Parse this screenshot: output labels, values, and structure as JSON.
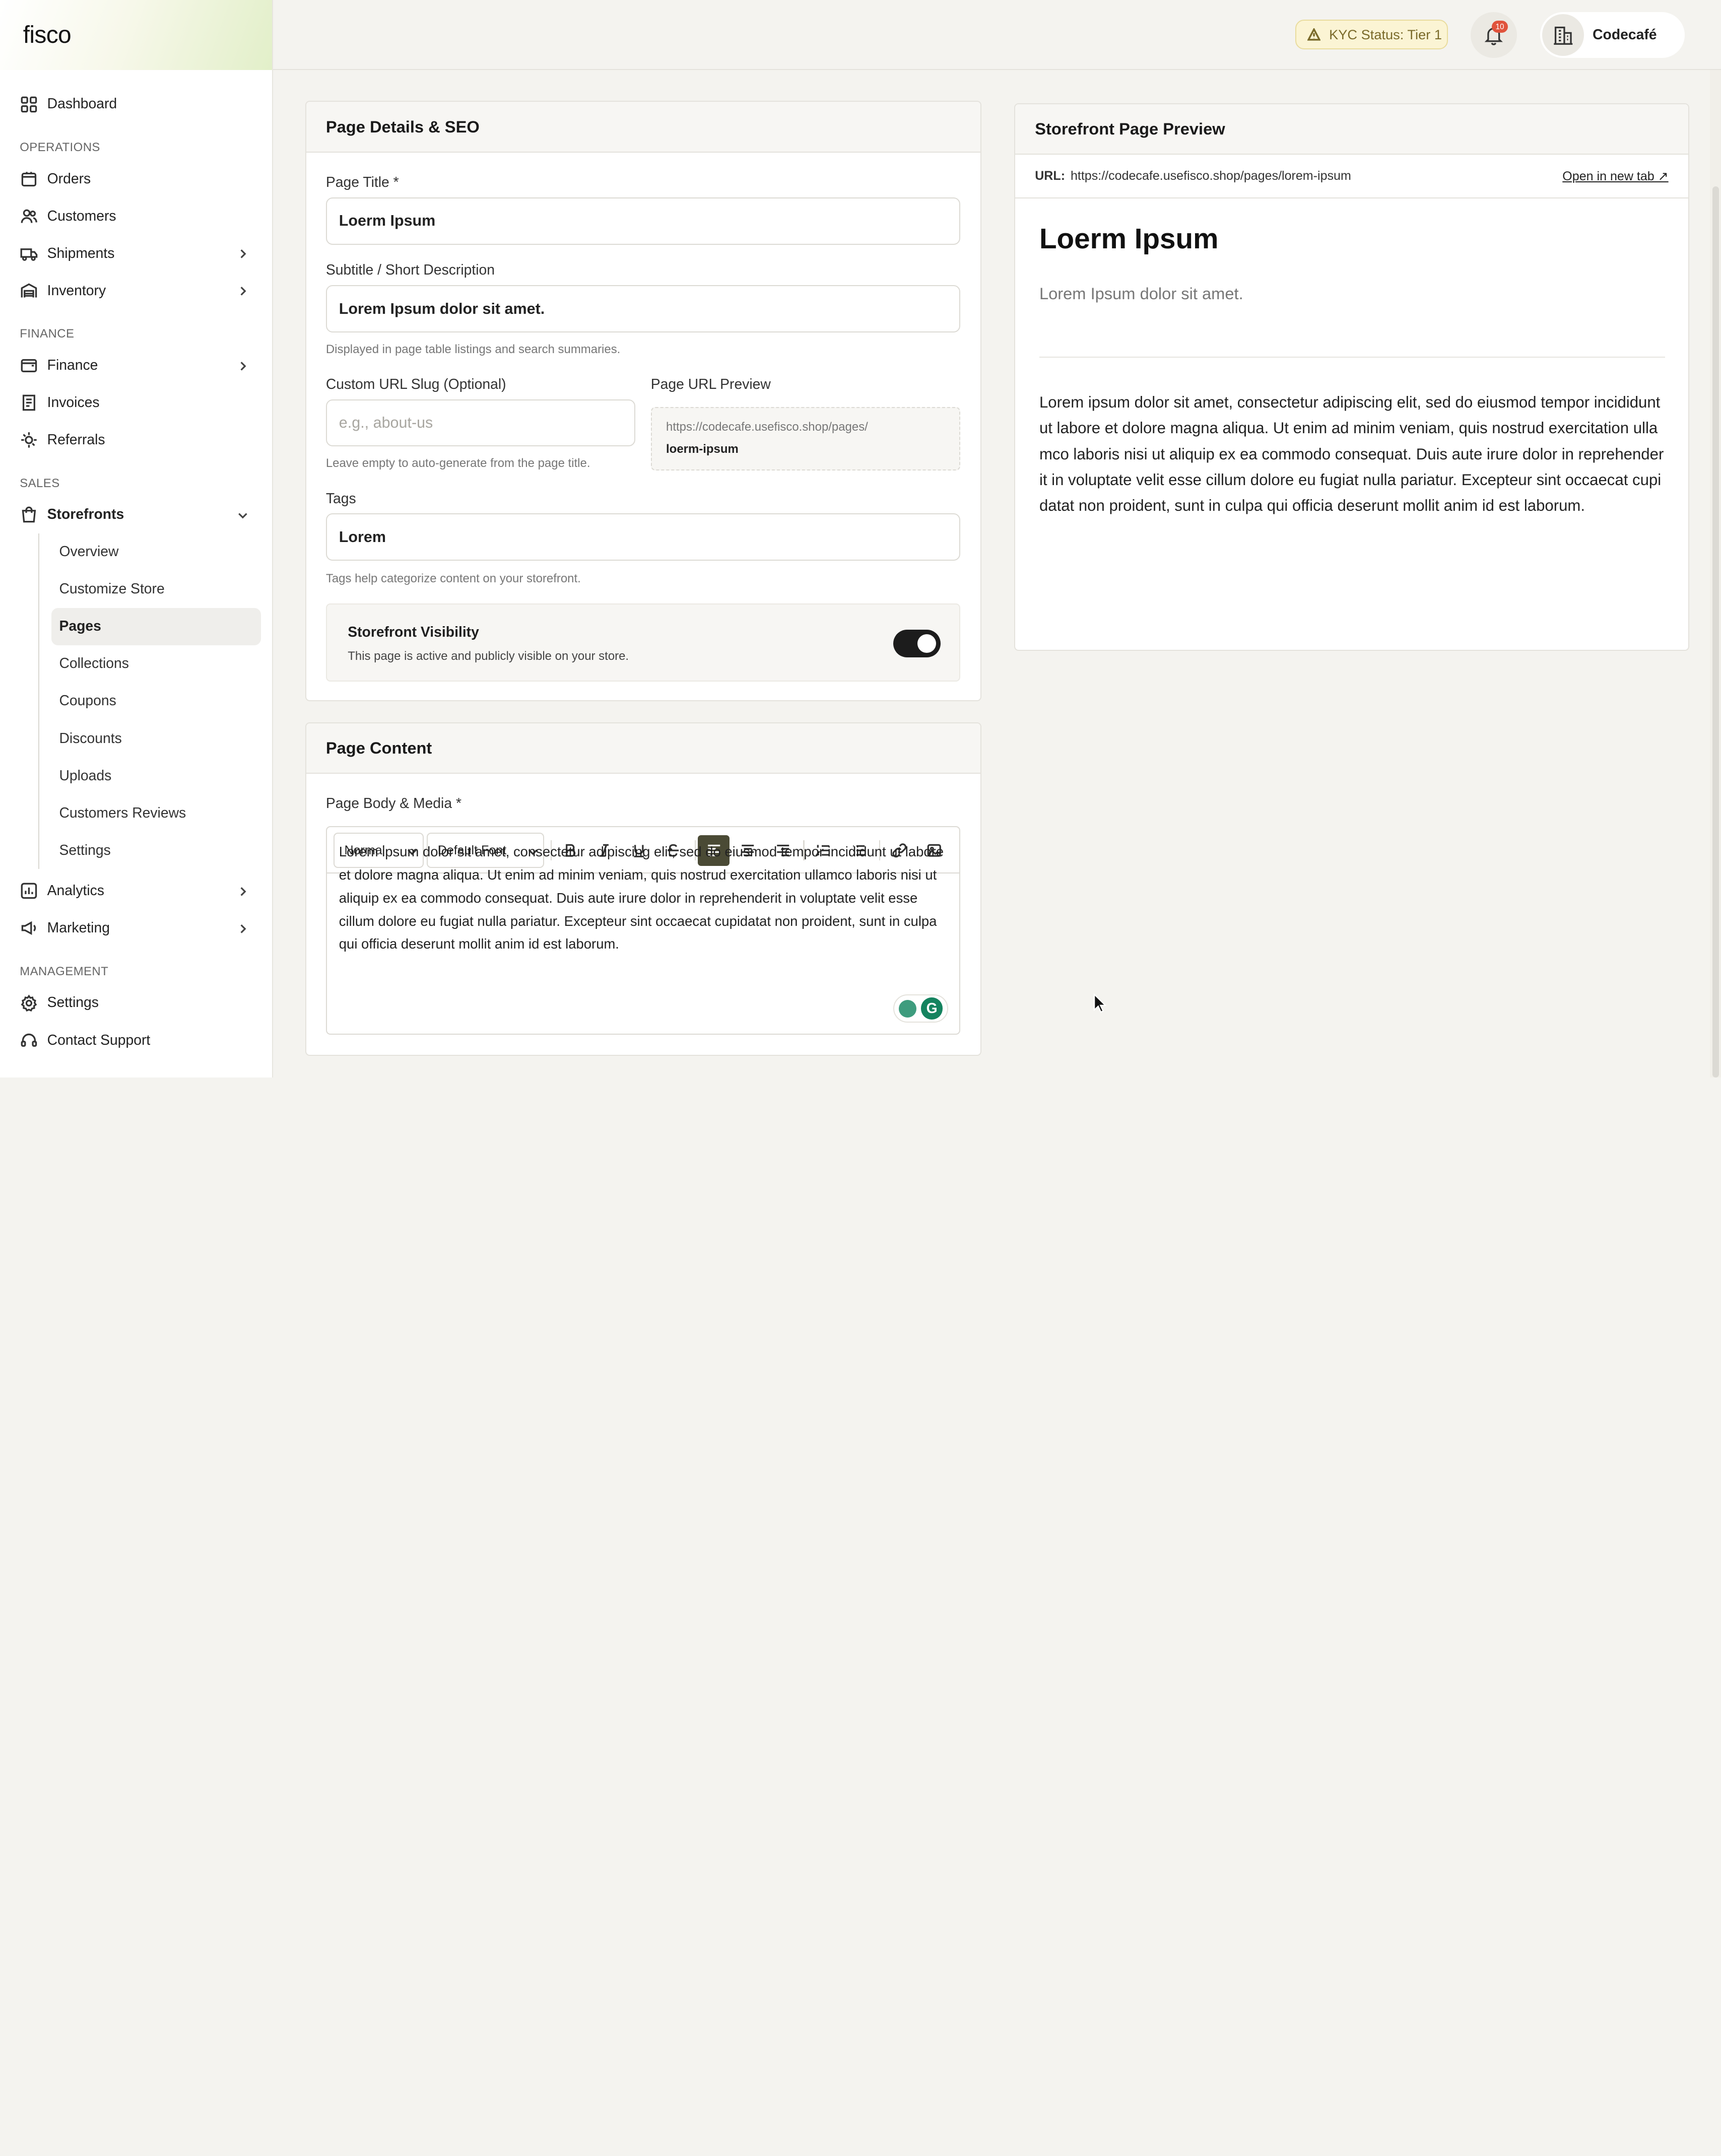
{
  "app": {
    "logo": "fisco"
  },
  "sidebar": {
    "dashboard": "Dashboard",
    "sections": {
      "operations": "OPERATIONS",
      "finance": "FINANCE",
      "sales": "SALES",
      "management": "MANAGEMENT"
    },
    "operations": [
      "Orders",
      "Customers",
      "Shipments",
      "Inventory"
    ],
    "finance": [
      "Finance",
      "Invoices",
      "Referrals"
    ],
    "storefronts": "Storefronts",
    "storefront_sub": [
      "Overview",
      "Customize Store",
      "Pages",
      "Collections",
      "Coupons",
      "Discounts",
      "Uploads",
      "Customers Reviews",
      "Settings"
    ],
    "sales_more": [
      "Analytics",
      "Marketing"
    ],
    "management": [
      "Settings",
      "Contact Support"
    ]
  },
  "header": {
    "kyc": "KYC Status: Tier 1",
    "notifications": "10",
    "account": "Codecafé"
  },
  "details": {
    "title": "Page Details & SEO",
    "page_title_label": "Page Title *",
    "page_title_value": "Loerm Ipsum",
    "subtitle_label": "Subtitle / Short Description",
    "subtitle_value": "Lorem Ipsum dolor sit amet.",
    "subtitle_hint": "Displayed in page table listings and search summaries.",
    "slug_label": "Custom URL Slug (Optional)",
    "slug_placeholder": "e.g., about-us",
    "slug_hint": "Leave empty to auto-generate from the page title.",
    "url_preview_label": "Page URL Preview",
    "url_base": "https://codecafe.usefisco.shop/pages/",
    "url_slug": "loerm-ipsum",
    "tags_label": "Tags",
    "tags_value": "Lorem",
    "tags_hint": "Tags help categorize content on your storefront.",
    "visibility_title": "Storefront Visibility",
    "visibility_desc": "This page is active and publicly visible on your store.",
    "visibility_on": true
  },
  "content": {
    "title": "Page Content",
    "body_label": "Page Body & Media *",
    "format": "Normal",
    "font": "Default Font",
    "body": "Lorem ipsum dolor sit amet, consectetur adipiscing elit, sed do eiusmod tempor incididunt ut labore et dolore magna aliqua. Ut enim ad minim veniam, quis nostrud exercitation ullamco laboris nisi ut aliquip ex ea commodo consequat. Duis aute irure dolor in reprehenderit in voluptate velit esse cillum dolore eu fugiat nulla pariatur. Excepteur sint occaecat cupidatat non proident, sunt in culpa qui officia deserunt mollit anim id est laborum."
  },
  "preview": {
    "title": "Storefront Page Preview",
    "url_label": "URL:",
    "url": "https://codecafe.usefisco.shop/pages/lorem-ipsum",
    "open": "Open in new tab ↗",
    "heading": "Loerm Ipsum",
    "subtitle": "Lorem Ipsum dolor sit amet.",
    "body": "Lorem ipsum dolor sit amet, consectetur adipiscing elit, sed do eiusmod tempor incididunt ut labore et dolore magna aliqua. Ut enim ad minim veniam, quis nostrud exercitation ullamco laboris nisi ut aliquip ex ea commodo consequat. Duis aute irure dolor in reprehenderit in voluptate velit esse cillum dolore eu fugiat nulla pariatur. Excepteur sint occaecat cupidatat non proident, sunt in culpa qui officia deserunt mollit anim id est laborum."
  },
  "colors": {
    "accent": "#4a4a35",
    "badge": "#e0533c",
    "kyc_bg": "#fbf4d4"
  }
}
